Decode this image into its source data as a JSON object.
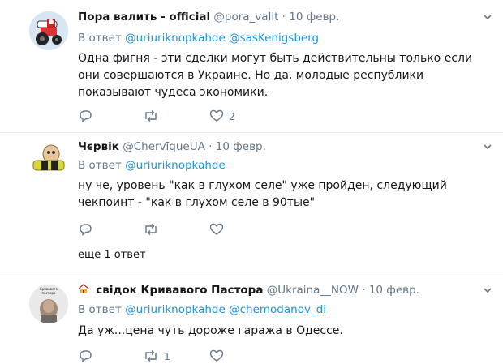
{
  "tweets": [
    {
      "name": "Пора валить - official",
      "handle": "@pora_valit",
      "separator": "·",
      "date": "10 февр.",
      "reply_prefix": "В ответ",
      "mentions": [
        "@uriuriknopkahde",
        "@sasKenigsberg"
      ],
      "text": "Одна фигня - эти сделки могут быть действительны только если они совершаются в Украине. Но да, молодые республики показывают чудеса экономики.",
      "avatar": "tractor-avatar-icon",
      "actions": {
        "reply_count": "",
        "retweet_count": "",
        "like_count": "2"
      }
    },
    {
      "name": "Чєрвік",
      "handle": "@ChervīqueUA",
      "separator": "·",
      "date": "10 февр.",
      "reply_prefix": "В ответ",
      "mentions": [
        "@uriuriknopkahde"
      ],
      "text": "ну че, уровень \"как в глухом селе\" уже пройден, следующий чекпоинт - \"как в глухом селе в 90тые\"",
      "avatar": "worm-avatar-icon",
      "actions": {
        "reply_count": "",
        "retweet_count": "",
        "like_count": ""
      },
      "more_replies": "еще 1 ответ"
    },
    {
      "name": "свідок Кривавого Пастора",
      "handle": "@Ukraina__NOW",
      "separator": "·",
      "date": "10 февр.",
      "reply_prefix": "В ответ",
      "mentions": [
        "@uriuriknopkahde",
        "@chemodanov_di"
      ],
      "text": "Да уж...цена чуть дороже гаража в Одессе.",
      "avatar": "photo-avatar-icon",
      "avatar_caption": "Кривавого пастора",
      "actions": {
        "reply_count": "",
        "retweet_count": "1",
        "like_count": ""
      }
    }
  ],
  "colors": {
    "accent": "#1b95e0",
    "muted": "#657786",
    "border": "#e6ecf0",
    "text": "#14171a"
  }
}
